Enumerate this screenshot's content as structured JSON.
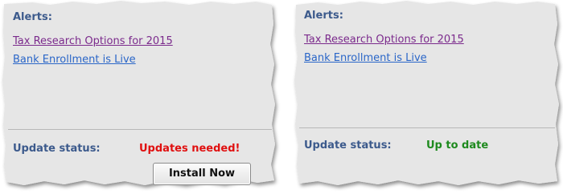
{
  "panels": [
    {
      "alerts_heading": "Alerts:",
      "alerts": [
        {
          "label": "Tax Research Options for 2015",
          "visited": true
        },
        {
          "label": "Bank Enrollment is Live",
          "visited": false
        }
      ],
      "status_label": "Update status:",
      "status_value": "Updates needed!",
      "status_color": "#e01010",
      "install_button_label": "Install Now"
    },
    {
      "alerts_heading": "Alerts:",
      "alerts": [
        {
          "label": "Tax Research Options for 2015",
          "visited": true
        },
        {
          "label": "Bank Enrollment is Live",
          "visited": false
        }
      ],
      "status_label": "Update status:",
      "status_value": "Up to date",
      "status_color": "#1e8a1e"
    }
  ],
  "colors": {
    "panel_background": "#e6e6e6",
    "heading": "#3c5a8c",
    "visited_link": "#7b2a8c",
    "link": "#2a66c8"
  }
}
